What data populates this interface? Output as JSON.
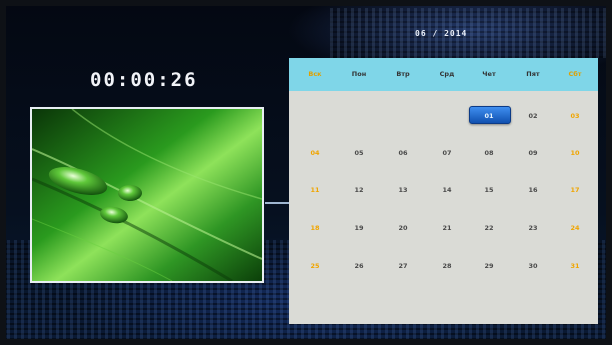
{
  "header": {
    "date_title": "06  /  2014"
  },
  "clock": {
    "time": "00:00:26"
  },
  "photo": {
    "icon": "leaf-dewdrop-photo"
  },
  "calendar": {
    "weekdays": [
      {
        "label": "Вск",
        "weekend": true
      },
      {
        "label": "Пон",
        "weekend": false
      },
      {
        "label": "Втр",
        "weekend": false
      },
      {
        "label": "Срд",
        "weekend": false
      },
      {
        "label": "Чет",
        "weekend": false
      },
      {
        "label": "Пят",
        "weekend": false
      },
      {
        "label": "Сбт",
        "weekend": true
      }
    ],
    "weeks": [
      [
        "",
        "",
        "",
        "",
        "01",
        "02",
        "03"
      ],
      [
        "04",
        "05",
        "06",
        "07",
        "08",
        "09",
        "10"
      ],
      [
        "11",
        "12",
        "13",
        "14",
        "15",
        "16",
        "17"
      ],
      [
        "18",
        "19",
        "20",
        "21",
        "22",
        "23",
        "24"
      ],
      [
        "25",
        "26",
        "27",
        "28",
        "29",
        "30",
        "31"
      ]
    ],
    "today": "01",
    "colors": {
      "header": "#7fd6e8",
      "weekend": "#f0a500",
      "today": "#1f6fd6",
      "body": "#dadbd6"
    }
  }
}
